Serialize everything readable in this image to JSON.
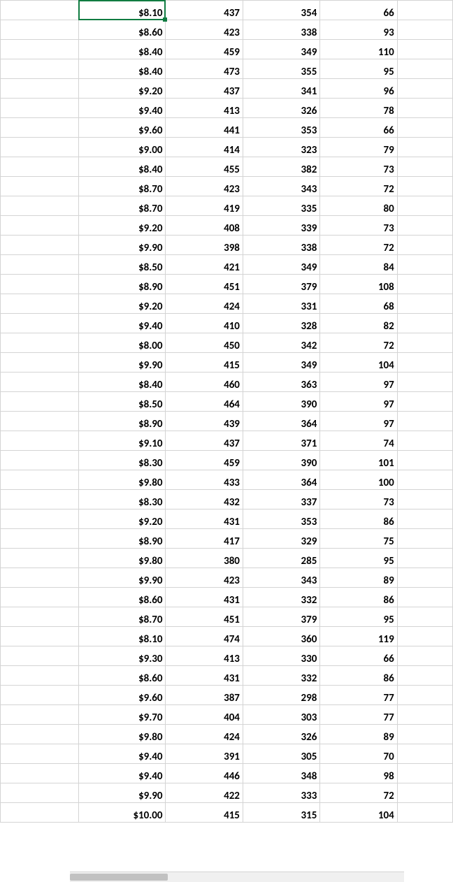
{
  "spreadsheet": {
    "active_cell": {
      "row": 0,
      "col": 1
    },
    "rows": [
      {
        "b": "$8.10",
        "c": "437",
        "d": "354",
        "e": "66"
      },
      {
        "b": "$8.60",
        "c": "423",
        "d": "338",
        "e": "93"
      },
      {
        "b": "$8.40",
        "c": "459",
        "d": "349",
        "e": "110"
      },
      {
        "b": "$8.40",
        "c": "473",
        "d": "355",
        "e": "95"
      },
      {
        "b": "$9.20",
        "c": "437",
        "d": "341",
        "e": "96"
      },
      {
        "b": "$9.40",
        "c": "413",
        "d": "326",
        "e": "78"
      },
      {
        "b": "$9.60",
        "c": "441",
        "d": "353",
        "e": "66"
      },
      {
        "b": "$9.00",
        "c": "414",
        "d": "323",
        "e": "79"
      },
      {
        "b": "$8.40",
        "c": "455",
        "d": "382",
        "e": "73"
      },
      {
        "b": "$8.70",
        "c": "423",
        "d": "343",
        "e": "72"
      },
      {
        "b": "$8.70",
        "c": "419",
        "d": "335",
        "e": "80"
      },
      {
        "b": "$9.20",
        "c": "408",
        "d": "339",
        "e": "73"
      },
      {
        "b": "$9.90",
        "c": "398",
        "d": "338",
        "e": "72"
      },
      {
        "b": "$8.50",
        "c": "421",
        "d": "349",
        "e": "84"
      },
      {
        "b": "$8.90",
        "c": "451",
        "d": "379",
        "e": "108"
      },
      {
        "b": "$9.20",
        "c": "424",
        "d": "331",
        "e": "68"
      },
      {
        "b": "$9.40",
        "c": "410",
        "d": "328",
        "e": "82"
      },
      {
        "b": "$8.00",
        "c": "450",
        "d": "342",
        "e": "72"
      },
      {
        "b": "$9.90",
        "c": "415",
        "d": "349",
        "e": "104"
      },
      {
        "b": "$8.40",
        "c": "460",
        "d": "363",
        "e": "97"
      },
      {
        "b": "$8.50",
        "c": "464",
        "d": "390",
        "e": "97"
      },
      {
        "b": "$8.90",
        "c": "439",
        "d": "364",
        "e": "97"
      },
      {
        "b": "$9.10",
        "c": "437",
        "d": "371",
        "e": "74"
      },
      {
        "b": "$8.30",
        "c": "459",
        "d": "390",
        "e": "101"
      },
      {
        "b": "$9.80",
        "c": "433",
        "d": "364",
        "e": "100"
      },
      {
        "b": "$8.30",
        "c": "432",
        "d": "337",
        "e": "73"
      },
      {
        "b": "$9.20",
        "c": "431",
        "d": "353",
        "e": "86"
      },
      {
        "b": "$8.90",
        "c": "417",
        "d": "329",
        "e": "75"
      },
      {
        "b": "$9.80",
        "c": "380",
        "d": "285",
        "e": "95"
      },
      {
        "b": "$9.90",
        "c": "423",
        "d": "343",
        "e": "89"
      },
      {
        "b": "$8.60",
        "c": "431",
        "d": "332",
        "e": "86"
      },
      {
        "b": "$8.70",
        "c": "451",
        "d": "379",
        "e": "95"
      },
      {
        "b": "$8.10",
        "c": "474",
        "d": "360",
        "e": "119"
      },
      {
        "b": "$9.30",
        "c": "413",
        "d": "330",
        "e": "66"
      },
      {
        "b": "$8.60",
        "c": "431",
        "d": "332",
        "e": "86"
      },
      {
        "b": "$9.60",
        "c": "387",
        "d": "298",
        "e": "77"
      },
      {
        "b": "$9.70",
        "c": "404",
        "d": "303",
        "e": "77"
      },
      {
        "b": "$9.80",
        "c": "424",
        "d": "326",
        "e": "89"
      },
      {
        "b": "$9.40",
        "c": "391",
        "d": "305",
        "e": "70"
      },
      {
        "b": "$9.40",
        "c": "446",
        "d": "348",
        "e": "98"
      },
      {
        "b": "$9.90",
        "c": "422",
        "d": "333",
        "e": "72"
      },
      {
        "b": "$10.00",
        "c": "415",
        "d": "315",
        "e": "104"
      }
    ]
  }
}
